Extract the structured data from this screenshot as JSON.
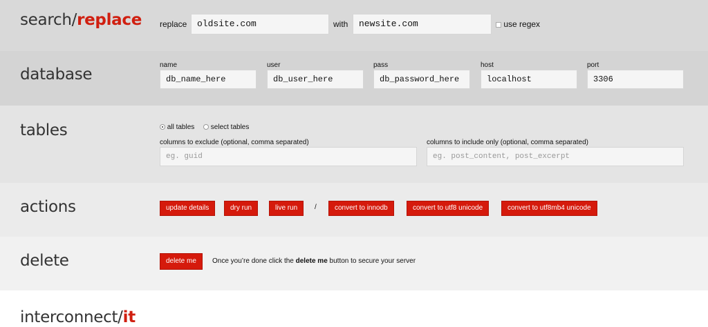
{
  "search": {
    "title_prefix": "search/",
    "title_suffix": "replace",
    "replace_label": "replace",
    "replace_value": "oldsite.com",
    "with_label": "with",
    "with_value": "newsite.com",
    "regex_label": "use regex"
  },
  "database": {
    "title": "database",
    "fields": [
      {
        "label": "name",
        "value": "db_name_here"
      },
      {
        "label": "user",
        "value": "db_user_here"
      },
      {
        "label": "pass",
        "value": "db_password_here"
      },
      {
        "label": "host",
        "value": "localhost"
      },
      {
        "label": "port",
        "value": "3306"
      }
    ]
  },
  "tables": {
    "title": "tables",
    "all_label": "all tables",
    "select_label": "select tables",
    "exclude_label": "columns to exclude (optional, comma separated)",
    "exclude_placeholder": "eg. guid",
    "include_label": "columns to include only (optional, comma separated)",
    "include_placeholder": "eg. post_content, post_excerpt"
  },
  "actions": {
    "title": "actions",
    "update": "update details",
    "dry_run": "dry run",
    "live_run": "live run",
    "separator": "/",
    "innodb": "convert to innodb",
    "utf8": "convert to utf8 unicode",
    "utf8mb4": "convert to utf8mb4 unicode"
  },
  "delete": {
    "title": "delete",
    "button": "delete me",
    "msg_before": "Once you’re done click the ",
    "msg_bold": "delete me",
    "msg_after": " button to secure your server"
  },
  "footer": {
    "brand_prefix": "interconnect/",
    "brand_suffix": "it"
  },
  "colors": {
    "accent": "#d51a0c"
  }
}
